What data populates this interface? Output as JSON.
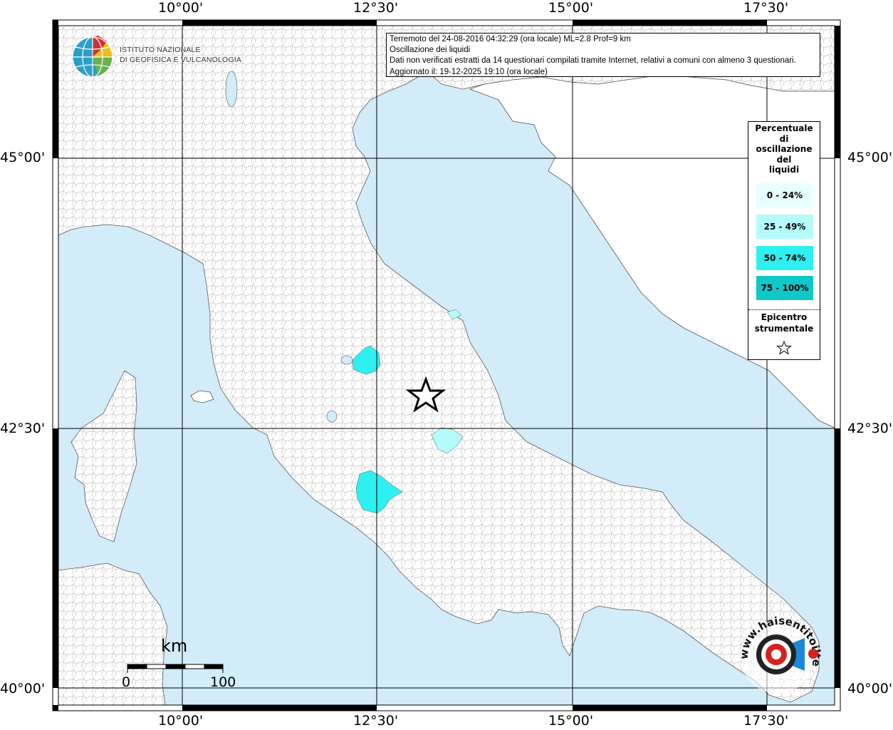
{
  "header": {
    "line1": "Terremoto del 24-08-2016 04:32:29 (ora locale) ML=2.8 Prof=9 km",
    "line2": "Oscillazione dei liquidi",
    "line3": "Dati non verificati estratti da 14 questionari compilati tramite Internet, relativi a comuni con almeno 3 questionari.",
    "line4": "Aggiornato il: 19-12-2025 19:10 (ora locale)"
  },
  "axes": {
    "top": [
      "10°00'",
      "12°30'",
      "15°00'",
      "17°30'"
    ],
    "bottom": [
      "10°00'",
      "12°30'",
      "15°00'",
      "17°30'"
    ],
    "left": [
      "45°00'",
      "42°30'",
      "40°00'"
    ],
    "right": [
      "45°00'",
      "42°30'",
      "40°00'"
    ]
  },
  "legend": {
    "title_lines": [
      "Percentuale",
      "di",
      "oscillazione",
      "del",
      "liquidi"
    ],
    "classes": [
      {
        "label": "0 - 24%",
        "color": "#e8ffff"
      },
      {
        "label": "25 - 49%",
        "color": "#b4fcfc"
      },
      {
        "label": "50 - 74%",
        "color": "#2ef0f0"
      },
      {
        "label": "75 - 100%",
        "color": "#10c8c8"
      }
    ],
    "epicenter_lines": [
      "Epicentro",
      "strumentale"
    ]
  },
  "logo": {
    "ingv_line1": "ISTITUTO NAZIONALE",
    "ingv_line2": "DI GEOFISICA E VULCANOLOGIA",
    "hst_text": "www.haisentitoilterremoto.it"
  },
  "scale": {
    "unit": "km",
    "start": "0",
    "end": "100"
  },
  "colors": {
    "sea": "#d2ecfa",
    "land": "#ffffff",
    "grid": "#000000"
  }
}
